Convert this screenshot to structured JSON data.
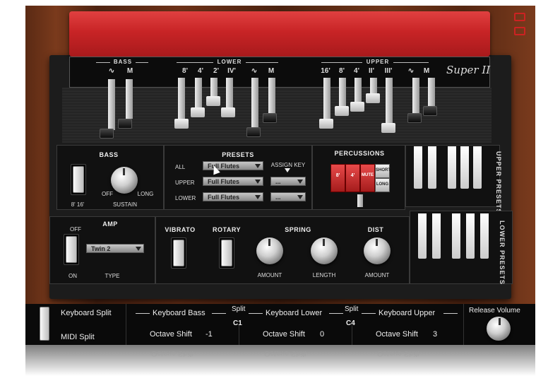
{
  "drawbar_sections": {
    "bass": {
      "title": "BASS",
      "labels": [
        "∿",
        "M"
      ]
    },
    "lower": {
      "title": "LOWER",
      "labels": [
        "8'",
        "4'",
        "2'",
        "IV'",
        "∿",
        "M"
      ]
    },
    "upper": {
      "title": "UPPER",
      "labels": [
        "16'",
        "8'",
        "4'",
        "II'",
        "III'",
        "∿",
        "M"
      ]
    }
  },
  "logo": "Super II",
  "bass_panel": {
    "title": "BASS",
    "switch_labels": "8'  16'",
    "off_label": "OFF",
    "long_label": "LONG",
    "sustain_label": "SUSTAIN"
  },
  "presets_panel": {
    "title": "PRESETS",
    "assign_key": "ASSIGN KEY",
    "rows": [
      {
        "label": "ALL",
        "value": "Full Flutes",
        "assign": ""
      },
      {
        "label": "UPPER",
        "value": "Full Flutes",
        "assign": "..."
      },
      {
        "label": "LOWER",
        "value": "Full Flutes",
        "assign": "..."
      }
    ]
  },
  "percussions_panel": {
    "title": "PERCUSSIONS",
    "buttons": [
      "8'",
      "4'",
      "MUTE",
      "SHORT",
      "LONG"
    ]
  },
  "upper_presets_label": "UPPER PRESETS",
  "lower_presets_label": "LOWER PRESETS",
  "amp_panel": {
    "title": "AMP",
    "off": "OFF",
    "on": "ON",
    "type_value": "Twin 2",
    "type_label": "TYPE"
  },
  "effects_panel": {
    "vibrato": "VIBRATO",
    "rotary": "ROTARY",
    "spring": "SPRING",
    "amount": "AMOUNT",
    "length": "LENGTH",
    "dist": "DIST",
    "dist_amount": "AMOUNT"
  },
  "bottom": {
    "keyboard_split": "Keyboard Split",
    "midi_split": "MIDI Split",
    "keyboard_bass": "Keyboard Bass",
    "keyboard_lower": "Keyboard Lower",
    "keyboard_upper": "Keyboard Upper",
    "split_label_1": "Split",
    "split_value_1": "C1",
    "split_label_2": "Split",
    "split_value_2": "C4",
    "octave_shift": "Octave Shift",
    "bass_octave": "-1",
    "lower_octave": "0",
    "upper_octave": "3",
    "release_volume": "Release Volume"
  },
  "colors": {
    "accent_red": "#c82426",
    "panel": "#111111",
    "wood": "#5a2a14"
  }
}
